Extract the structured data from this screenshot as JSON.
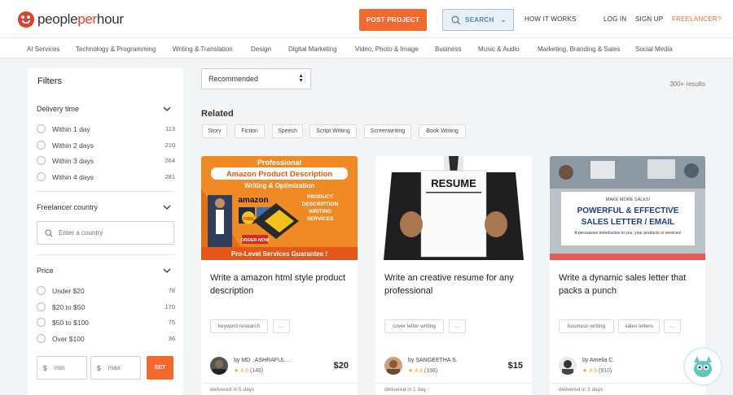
{
  "header": {
    "logo": {
      "part1": "people",
      "part2": "per",
      "part3": "hour"
    },
    "post_project": "POST PROJECT",
    "search": "SEARCH",
    "how_it_works": "HOW IT WORKS",
    "log_in": "LOG IN",
    "sign_up": "SIGN UP",
    "freelancer": "FREELANCER?"
  },
  "categories": [
    "AI Services",
    "Technology & Programming",
    "Writing & Translation",
    "Design",
    "Digital Marketing",
    "Video, Photo & Image",
    "Business",
    "Music & Audio",
    "Marketing, Branding & Sales",
    "Social Media"
  ],
  "filters": {
    "title": "Filters",
    "delivery": {
      "title": "Delivery time",
      "options": [
        {
          "label": "Within 1 day",
          "count": "113"
        },
        {
          "label": "Within 2 days",
          "count": "210"
        },
        {
          "label": "Within 3 days",
          "count": "264"
        },
        {
          "label": "Within 4 days",
          "count": "281"
        }
      ]
    },
    "country": {
      "title": "Freelancer country",
      "placeholder": "Enter a country"
    },
    "price": {
      "title": "Price",
      "options": [
        {
          "label": "Under $20",
          "count": "78"
        },
        {
          "label": "$20 to $50",
          "count": "170"
        },
        {
          "label": "$50 to $100",
          "count": "75"
        },
        {
          "label": "Over $100",
          "count": "36"
        }
      ],
      "currency": "$",
      "min_placeholder": "min",
      "max_placeholder": "max",
      "set": "SET"
    }
  },
  "main": {
    "sort": "Recommended",
    "results": "300+ results",
    "related_title": "Related",
    "related": [
      "Story",
      "Fiction",
      "Speech",
      "Script Writing",
      "Screenwriting",
      "Book Writing"
    ]
  },
  "cards": [
    {
      "title": "Write a amazon html style product description",
      "tags": [
        "keyword research",
        "..."
      ],
      "by": "by MD . ASHRAFUL...",
      "rating": "4.8",
      "reviews": "(148)",
      "price": "$20",
      "delivered": "delivered in 5 days",
      "thumb": {
        "heading": "Professional",
        "banner": "Amazon Product Description",
        "sub": "Writing & Optimization",
        "brand": "amazon",
        "side1": "PRODUCT",
        "side2": "DESCRIPTION",
        "side3": "WRITING",
        "side4": "SERVICES",
        "badge": "FREE",
        "order": "ORDER NOW",
        "footer": "Pro-Level Services Guarantee !"
      }
    },
    {
      "title": "Write an creative resume for any professional",
      "tags": [
        "cover letter writing",
        "..."
      ],
      "by": "by SANGEETHA S.",
      "rating": "4.9",
      "reviews": "(198)",
      "price": "$15",
      "delivered": "delivered in 1 day",
      "thumb": {
        "paper": "RESUME"
      }
    },
    {
      "title": "Write a dynamic sales letter that packs a punch",
      "tags": [
        "business writing",
        "sales letters",
        "..."
      ],
      "by": "by Amelia C.",
      "rating": "4.9",
      "reviews": "(910)",
      "price": "$",
      "delivered": "delivered in 3 days",
      "thumb": {
        "top": "MAKE MORE SALES!",
        "line1": "POWERFUL & EFFECTIVE",
        "line2": "SALES LETTER / EMAIL",
        "sub": "A persuasive introduction to you, your products or services!"
      }
    }
  ],
  "colors": {
    "accent": "#f26a2e",
    "brand_red": "#e0422f",
    "star": "#f4a623"
  }
}
